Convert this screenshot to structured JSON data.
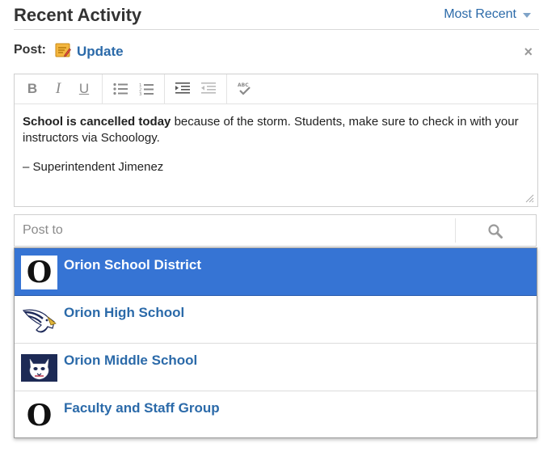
{
  "header": {
    "title": "Recent Activity",
    "sort_label": "Most Recent"
  },
  "post": {
    "label": "Post:",
    "type_label": "Update",
    "close_glyph": "×"
  },
  "editor": {
    "toolbar": [
      "bold",
      "italic",
      "underline",
      "bulleted-list",
      "numbered-list",
      "indent",
      "outdent",
      "spellcheck"
    ],
    "bold_glyph": "B",
    "italic_glyph": "I",
    "underline_glyph": "U",
    "line1_bold": "School is cancelled today",
    "line1_rest": " because of the storm. Students, make sure to check in with your instructors via Schoology.",
    "signature": "– Superintendent Jimenez"
  },
  "postto": {
    "placeholder": "Post to"
  },
  "options": [
    {
      "name": "Orion School District",
      "logo": "O",
      "selected": true
    },
    {
      "name": "Orion High School",
      "logo": "eagle-logo",
      "selected": false
    },
    {
      "name": "Orion Middle School",
      "logo": "wildcat-logo",
      "selected": false
    },
    {
      "name": "Faculty and Staff Group",
      "logo": "O",
      "selected": false
    }
  ],
  "colors": {
    "link": "#2b6aa9",
    "selected_bg": "#3674d4"
  }
}
